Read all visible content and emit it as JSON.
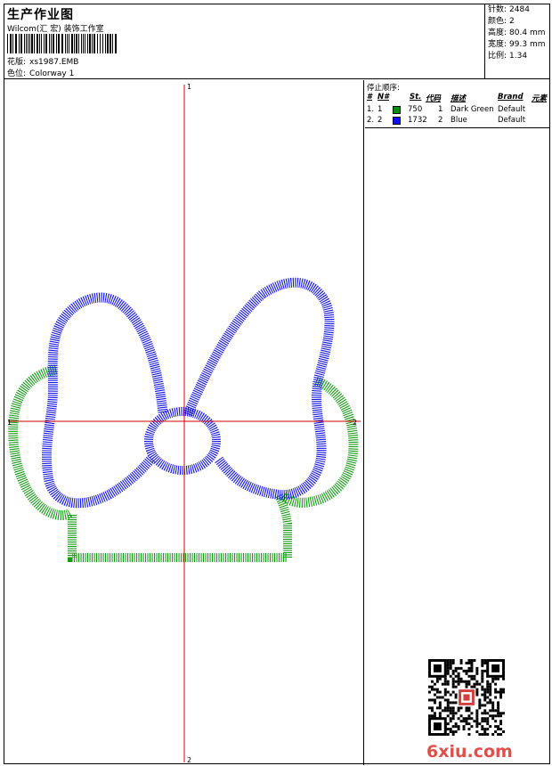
{
  "header": {
    "title": "生产作业图",
    "company": "Wilcom(汇 宏) 装饰工作室",
    "pattern_label": "花版:",
    "pattern_value": "xs1987.EMB",
    "colorway_label": "色位:",
    "colorway_value": "Colorway 1"
  },
  "stats": [
    {
      "label": "针数:",
      "value": "2484"
    },
    {
      "label": "颜色:",
      "value": "2"
    },
    {
      "label": "高度:",
      "value": "80.4 mm"
    },
    {
      "label": "宽度:",
      "value": "99.3 mm"
    },
    {
      "label": "比例:",
      "value": "1.34"
    }
  ],
  "stop_sequence": {
    "title": "停止顺序:",
    "headers": {
      "idx": "#",
      "n": "N#",
      "st": "St.",
      "code": "代码",
      "desc": "描述",
      "brand": "Brand",
      "elem": "元素"
    },
    "rows": [
      {
        "idx": "1.",
        "n": "1",
        "st": "750",
        "code": "1",
        "desc": "Dark Green",
        "brand": "Default",
        "color": "#0a8a0a"
      },
      {
        "idx": "2.",
        "n": "2",
        "st": "1732",
        "code": "2",
        "desc": "Blue",
        "brand": "Default",
        "color": "#1010e8"
      }
    ]
  },
  "markers": {
    "top": "1",
    "bottom": "2",
    "left": "1",
    "right": "2"
  },
  "colors": {
    "green": "#1a9a1a",
    "blue": "#1414e6",
    "crosshair": "#d00000"
  },
  "watermark": "6xiu.com"
}
